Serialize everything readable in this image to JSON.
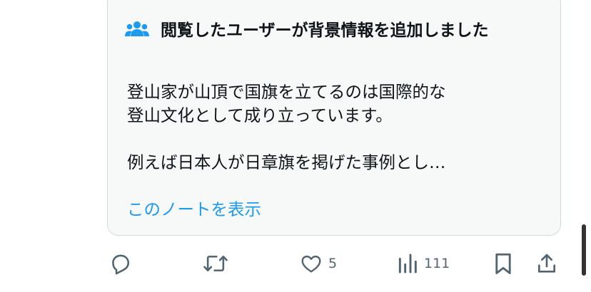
{
  "note": {
    "header_icon": "people-icon",
    "title": "閲覧したユーザーが背景情報を追加しました",
    "body": "登山家が山頂で国旗を立てるのは国際的な\n登山文化として成り立っています。\n\n例えば日本人が日章旗を掲げた事例とし…",
    "show_note_link": "このノートを表示"
  },
  "actions": {
    "reply_icon": "reply-icon",
    "repost_icon": "repost-icon",
    "like_icon": "heart-icon",
    "like_count": "5",
    "views_icon": "analytics-icon",
    "views_count": "111",
    "bookmark_icon": "bookmark-icon",
    "share_icon": "share-icon"
  },
  "colors": {
    "accent": "#1d9bf0",
    "text": "#0f1419",
    "muted": "#536471",
    "card_background": "#f7f9f9",
    "card_border": "#cfd9de"
  }
}
